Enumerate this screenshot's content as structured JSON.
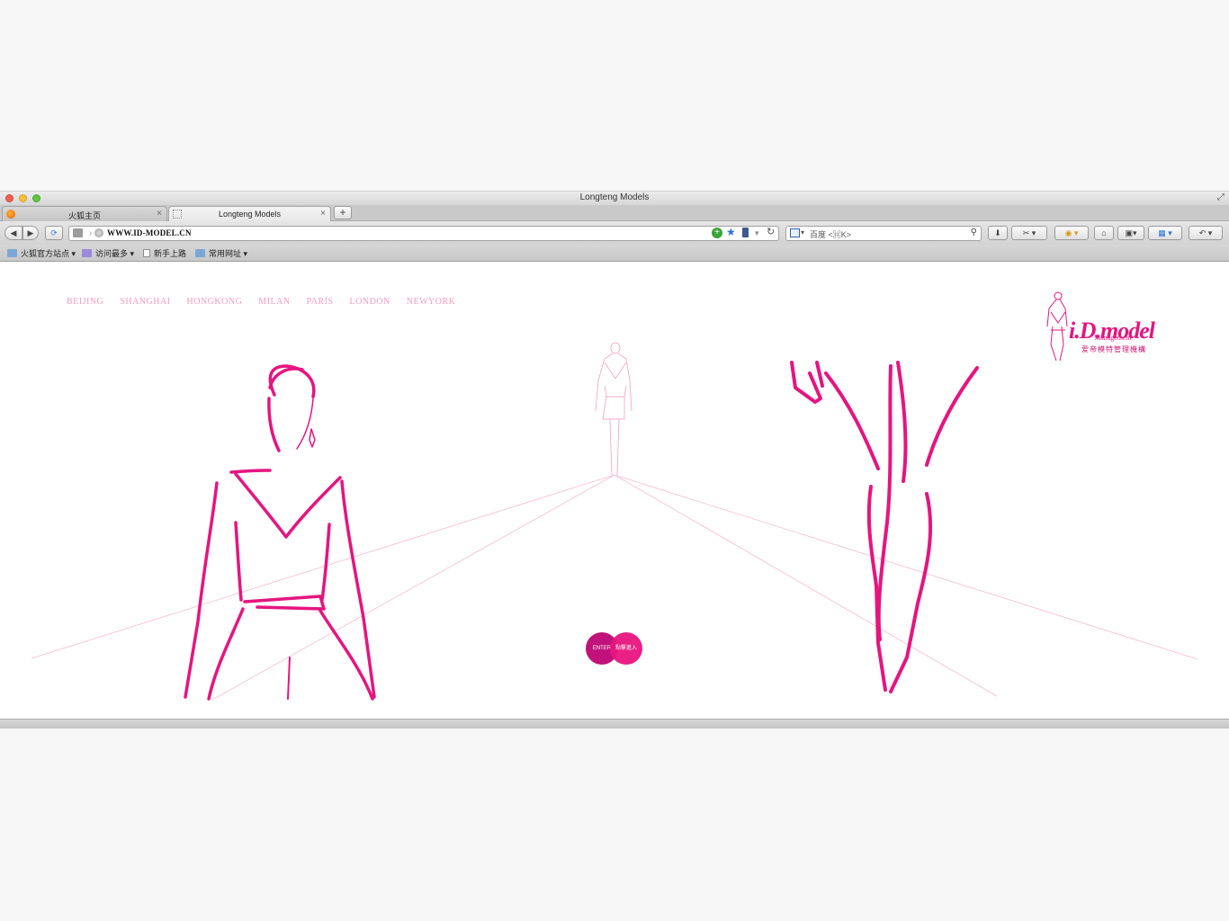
{
  "window": {
    "title": "Longteng Models"
  },
  "tabs": [
    {
      "label": "火狐主页",
      "active": false
    },
    {
      "label": "Longteng Models",
      "active": true
    }
  ],
  "toolbar": {
    "url": "WWW.ID-MODEL.CN",
    "search_placeholder": "百度 <⌘K>"
  },
  "bookmarks": [
    {
      "label": "火狐官方站点",
      "icon": "folder-icon"
    },
    {
      "label": "访问最多",
      "icon": "smart-folder-icon"
    },
    {
      "label": "新手上路",
      "icon": "page-icon"
    },
    {
      "label": "常用网址",
      "icon": "folder-icon"
    }
  ],
  "site": {
    "cities": [
      "BEIJING",
      "SHANGHAI",
      "HONGKONG",
      "MILAN",
      "PARIS",
      "LONDON",
      "NEWYORK"
    ],
    "logo": {
      "main": "i.D.model",
      "sub": "Management",
      "cn": "爱帝模特管理機構"
    },
    "enter": {
      "en": "ENTER",
      "cn": "點擊進入"
    }
  },
  "colors": {
    "brand": "#e5157f",
    "city_links": "#f29cc0",
    "runway_lines": "#f4bcd3",
    "enter_left": "#c0127a",
    "enter_right": "#e8157f"
  }
}
